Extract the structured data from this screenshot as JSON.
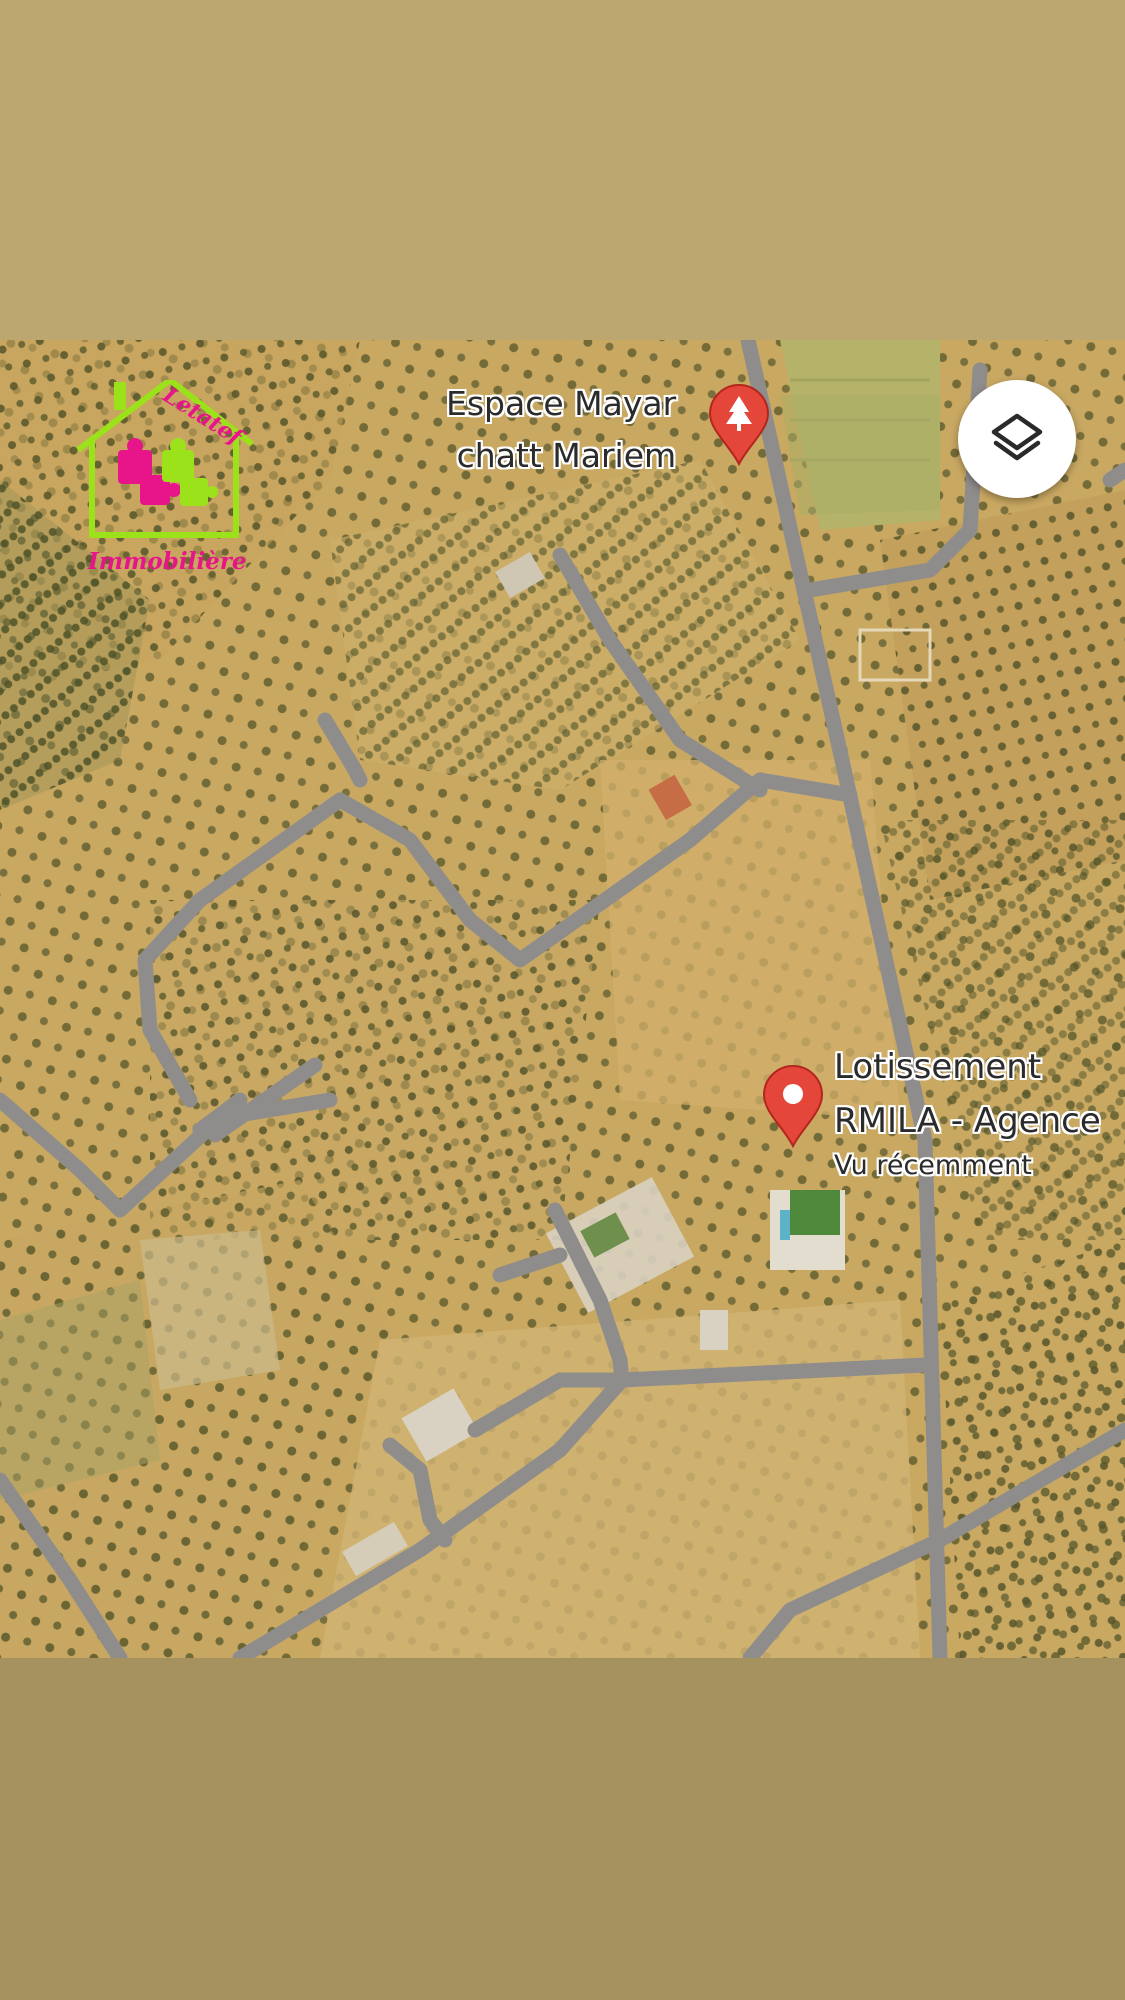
{
  "map": {
    "places": [
      {
        "name_line1": "Espace Mayar",
        "name_line2": "chatt Mariem",
        "pin_type": "park-pin"
      },
      {
        "name_line1": "Lotissement",
        "name_line2": "RMILA - Agence",
        "status": "Vu récemment",
        "pin_type": "location-pin"
      }
    ],
    "layers_button_icon": "layers-icon"
  },
  "watermark": {
    "top_text": "Letatef",
    "bottom_text": "Immobilière",
    "colors": {
      "house": "#9be21b",
      "puzzle_pink": "#e8148a",
      "puzzle_green": "#9be21b"
    }
  },
  "colors": {
    "band_top": "#bda770",
    "band_bottom": "#a5925f",
    "road": "#8e8c8a",
    "pin": "#e4463a"
  }
}
